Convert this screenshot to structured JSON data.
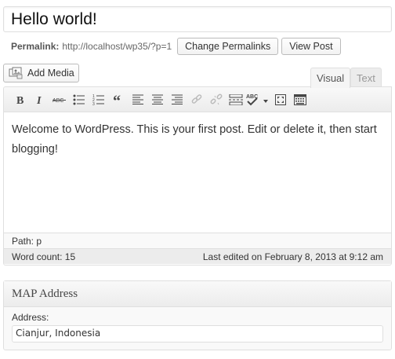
{
  "post": {
    "title": "Hello world!"
  },
  "permalink": {
    "label": "Permalink:",
    "url": "http://localhost/wp35/?p=1",
    "change_button": "Change Permalinks",
    "view_button": "View Post"
  },
  "media": {
    "add_media_label": "Add Media"
  },
  "tabs": {
    "visual": "Visual",
    "text": "Text"
  },
  "toolbar": {
    "buttons": [
      "bold-icon",
      "italic-icon",
      "strikethrough-icon",
      "bulleted-list-icon",
      "numbered-list-icon",
      "blockquote-icon",
      "align-left-icon",
      "align-center-icon",
      "align-right-icon",
      "insert-link-icon",
      "unlink-icon",
      "more-tag-icon",
      "spellcheck-icon",
      "fullscreen-icon",
      "kitchen-sink-icon"
    ],
    "spellcheck_text": "ABC"
  },
  "editor": {
    "content": "Welcome to WordPress. This is your first post. Edit or delete it, then start blogging!",
    "path": "Path: p",
    "word_count": "Word count: 15",
    "last_edited": "Last edited on February 8, 2013 at 9:12 am"
  },
  "map_box": {
    "title": "MAP Address",
    "address_label": "Address:",
    "address_value": "Cianjur, Indonesia"
  }
}
